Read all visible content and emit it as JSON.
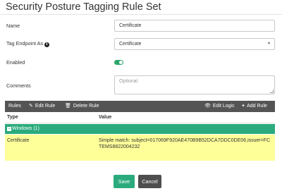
{
  "page": {
    "title": "Security Posture Tagging Rule Set"
  },
  "form": {
    "name_label": "Name",
    "name_value": "Certificate",
    "tag_label": "Tag Endpoint As",
    "tag_info_glyph": "i",
    "tag_value": "Certificate",
    "tag_caret": "▲\n▼",
    "enabled_label": "Enabled",
    "enabled": true,
    "comments_label": "Comments",
    "comments_placeholder": "Optional"
  },
  "toolbar": {
    "rules_label": "Rules",
    "edit_rule_label": "Edit Rule",
    "delete_rule_label": "Delete Rule",
    "edit_logic_label": "Edit Logic",
    "add_rule_label": "Add Rule"
  },
  "table": {
    "columns": [
      "Type",
      "Value"
    ],
    "group_label": "Windows (1)",
    "rows": [
      {
        "type": "Certificate",
        "value": "Simple match: subject=017069F920AE470B9B52DCA7DDC0DE06,issuer=FCTEMS8822004232"
      }
    ]
  },
  "actions": {
    "save_label": "Save",
    "cancel_label": "Cancel"
  },
  "colors": {
    "accent": "#2bab7d",
    "toolbar": "#545454",
    "highlight_row": "#ffff99",
    "cancel": "#4e4e4e"
  }
}
